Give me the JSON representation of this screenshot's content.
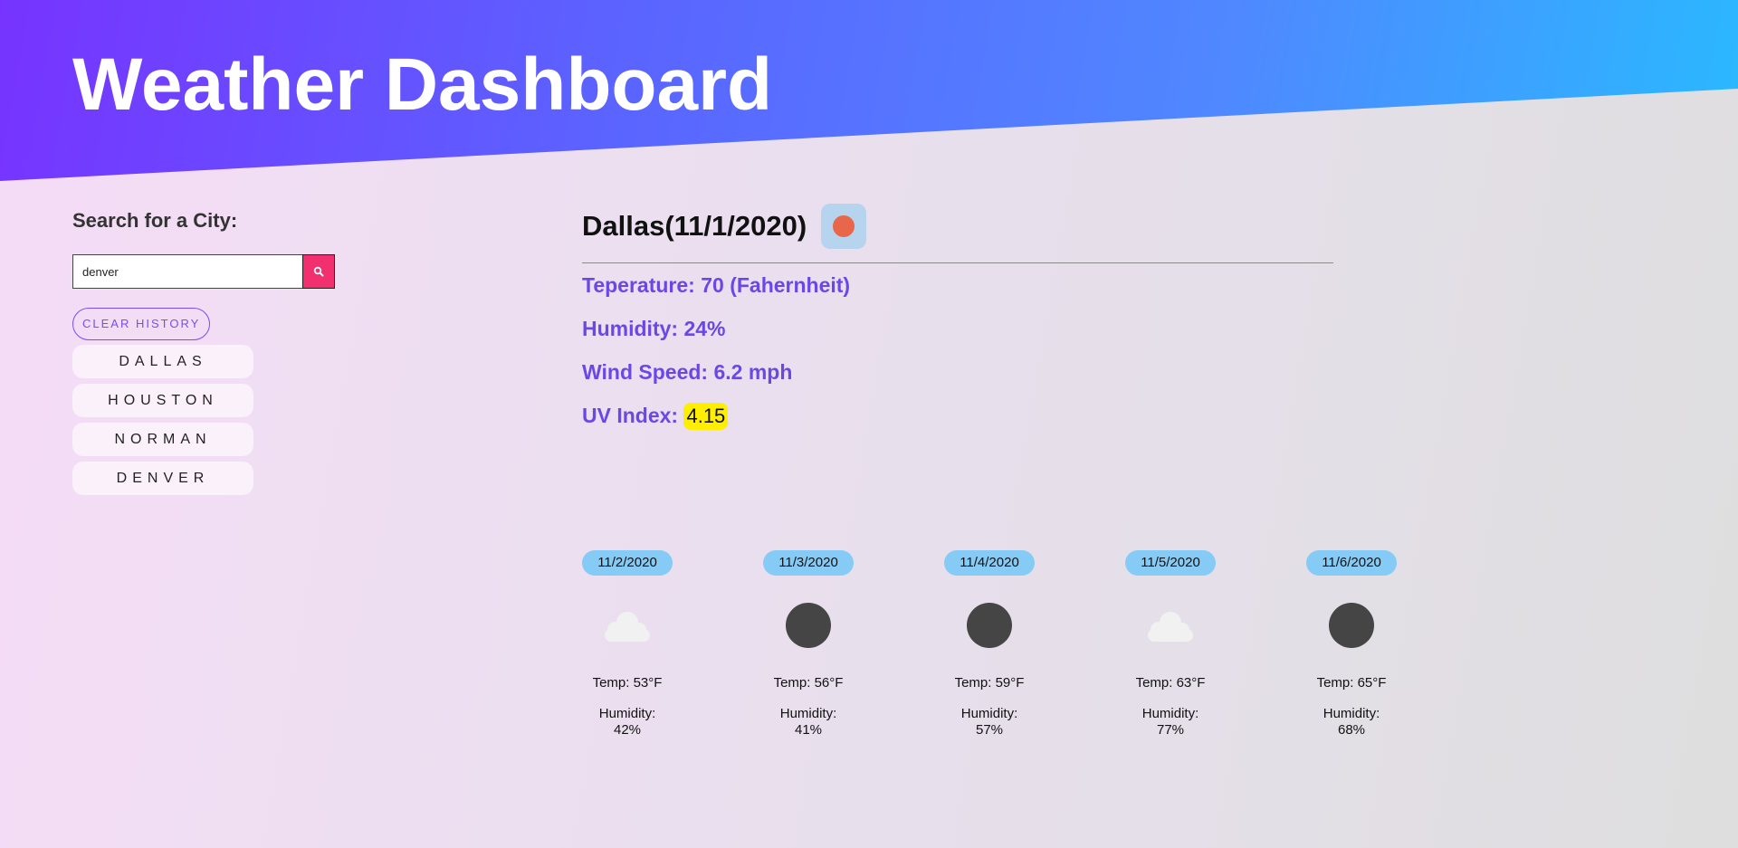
{
  "header": {
    "title": "Weather Dashboard"
  },
  "search": {
    "label": "Search for a City:",
    "value": "denver",
    "button_icon": "search-icon"
  },
  "clear_history_label": "CLEAR HISTORY",
  "history": [
    {
      "label": "DALLAS"
    },
    {
      "label": "HOUSTON"
    },
    {
      "label": "NORMAN"
    },
    {
      "label": "DENVER"
    }
  ],
  "current": {
    "title": "Dallas(11/1/2020)",
    "icon": "sun-icon",
    "temperature": "Teperature: 70 (Fahernheit)",
    "humidity": "Humidity: 24%",
    "wind": "Wind Speed: 6.2 mph",
    "uv_label": "UV Index:",
    "uv_value": "4.15"
  },
  "forecast": [
    {
      "date": "11/2/2020",
      "icon": "cloud-icon",
      "temp": "Temp: 53°F",
      "humidity_label": "Humidity:",
      "humidity": "42%"
    },
    {
      "date": "11/3/2020",
      "icon": "moon-icon",
      "temp": "Temp: 56°F",
      "humidity_label": "Humidity:",
      "humidity": "41%"
    },
    {
      "date": "11/4/2020",
      "icon": "moon-icon",
      "temp": "Temp: 59°F",
      "humidity_label": "Humidity:",
      "humidity": "57%"
    },
    {
      "date": "11/5/2020",
      "icon": "cloud-icon",
      "temp": "Temp: 63°F",
      "humidity_label": "Humidity:",
      "humidity": "77%"
    },
    {
      "date": "11/6/2020",
      "icon": "moon-icon",
      "temp": "Temp: 65°F",
      "humidity_label": "Humidity:",
      "humidity": "68%"
    }
  ],
  "colors": {
    "header_start": "#7733ff",
    "header_end": "#2ab9ff",
    "accent_text": "#6a48e6",
    "search_button": "#f2306f",
    "uv_highlight": "#ffee00",
    "forecast_date_bg": "#86cbf5"
  }
}
